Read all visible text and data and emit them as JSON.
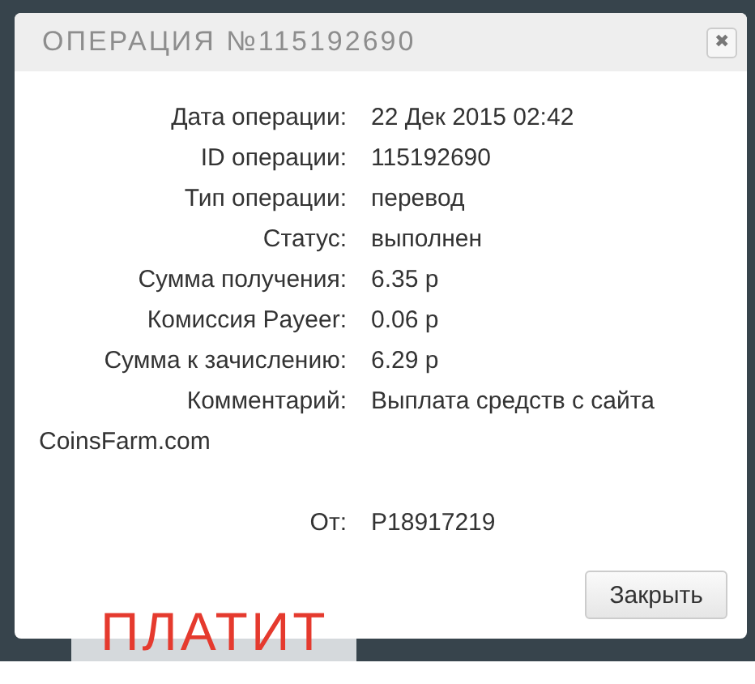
{
  "dialog": {
    "title": "ОПЕРАЦИЯ №115192690",
    "close_icon": "✖",
    "fields": [
      {
        "label": "Дата операции:",
        "value": "22 Дек 2015 02:42"
      },
      {
        "label": "ID операции:",
        "value": "115192690"
      },
      {
        "label": "Тип операции:",
        "value": "перевод"
      },
      {
        "label": "Статус:",
        "value": "выполнен"
      },
      {
        "label": "Сумма получения:",
        "value": "6.35 р"
      },
      {
        "label": "Комиссия Payeer:",
        "value": "0.06 р"
      },
      {
        "label": "Сумма к зачислению:",
        "value": "6.29 р"
      },
      {
        "label": "Комментарий:",
        "value": "Выплата средств с сайта",
        "continuation": "CoinsFarm.com"
      }
    ],
    "from": {
      "label": "От:",
      "value": "P18917219"
    },
    "buttons": [
      "Закрыть"
    ]
  },
  "annotation": "ПЛАТИТ"
}
